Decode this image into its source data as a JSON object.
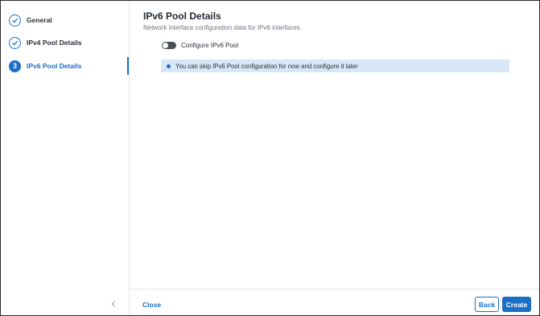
{
  "wizard": {
    "steps": [
      {
        "label": "General",
        "state": "complete",
        "icon": "check-icon"
      },
      {
        "label": "IPv4 Pool Details",
        "state": "complete",
        "icon": "check-icon"
      },
      {
        "label": "IPv6 Pool Details",
        "state": "active",
        "number": "3"
      }
    ],
    "collapse_icon": "chevron-left-icon"
  },
  "main": {
    "title": "IPv6 Pool Details",
    "subtitle": "Network interface configuration data for IPv6 interfaces.",
    "toggle": {
      "label": "Configure IPv6 Pool",
      "on": false
    },
    "info": {
      "text": "You can skip IPv6 Pool configuration for now and configure it later",
      "icon": "info-dot-icon"
    }
  },
  "footer": {
    "close_label": "Close",
    "back_label": "Back",
    "create_label": "Create"
  },
  "colors": {
    "accent": "#1b6fc4",
    "info_bg": "#d7e7f7",
    "toggle_off": "#4a4f55"
  }
}
